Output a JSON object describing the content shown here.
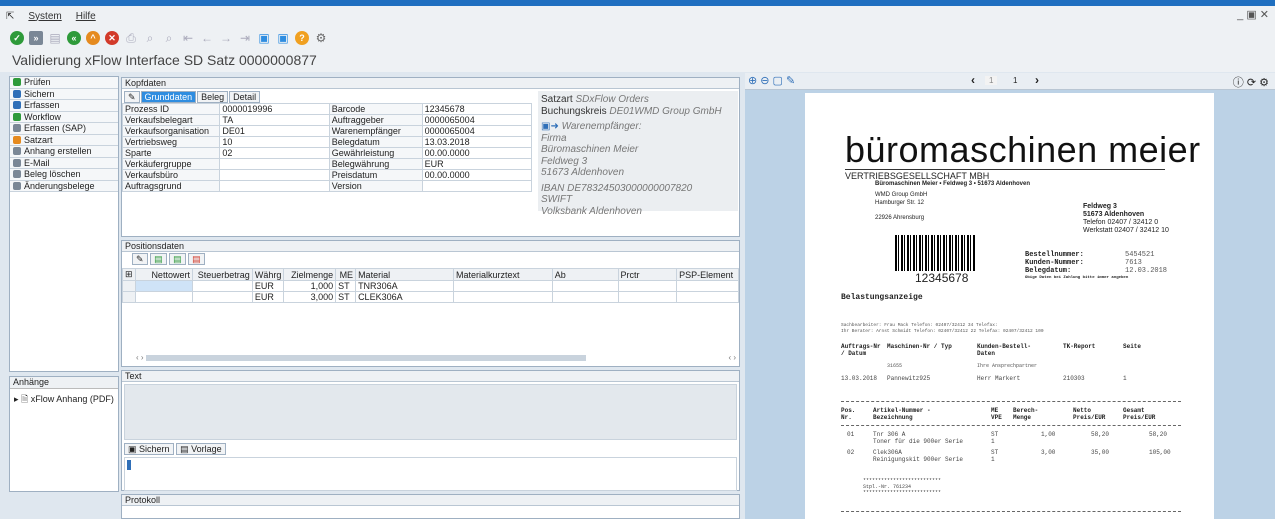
{
  "menu": {
    "system": "System",
    "hilfe": "Hilfe"
  },
  "title": "Validierung xFlow Interface SD Satz 0000000877",
  "nav": [
    "Prüfen",
    "Sichern",
    "Erfassen",
    "Workflow",
    "Erfassen (SAP)",
    "Satzart",
    "Anhang erstellen",
    "E-Mail",
    "Beleg löschen",
    "Änderungsbelege"
  ],
  "anhaenge": {
    "header": "Anhänge",
    "item": "xFlow Anhang (PDF)"
  },
  "kopf": {
    "header": "Kopfdaten",
    "tabs": [
      "Grunddaten",
      "Beleg",
      "Detail"
    ],
    "rows": [
      [
        "Prozess ID",
        "0000019996",
        "Barcode",
        "12345678"
      ],
      [
        "Verkaufsbelegart",
        "TA",
        "Auftraggeber",
        "0000065004"
      ],
      [
        "Verkaufsorganisation",
        "DE01",
        "Warenempfänger",
        "0000065004"
      ],
      [
        "Vertriebsweg",
        "10",
        "Belegdatum",
        "13.03.2018"
      ],
      [
        "Sparte",
        "02",
        "Gewährleistung",
        "00.00.0000"
      ],
      [
        "Verkäufergruppe",
        "",
        "Belegwährung",
        "EUR"
      ],
      [
        "Verkaufsbüro",
        "",
        "Preisdatum",
        "00.00.0000"
      ],
      [
        "Auftragsgrund",
        "",
        "Version",
        ""
      ]
    ]
  },
  "info": {
    "satzart_l": "Satzart",
    "satzart_v": "SDxFlow Orders",
    "bk_l": "Buchungskreis",
    "bk_v": "DE01WMD Group GmbH",
    "we": "Warenempfänger:",
    "l1": "Firma",
    "l2": "Büromaschinen Meier",
    "l3": "Feldweg 3",
    "l4": "51673 Aldenhoven",
    "l5": "IBAN DE78324503000000007820",
    "l6": "SWIFT",
    "l7": "Volksbank Aldenhoven"
  },
  "pos": {
    "header": "Positionsdaten",
    "cols": [
      "Nettowert",
      "Steuerbetrag",
      "Währg",
      "Zielmenge",
      "ME",
      "Material",
      "Materialkurztext",
      "Ab",
      "Prctr",
      "PSP-Element"
    ],
    "rows": [
      [
        "",
        "",
        "EUR",
        "1,000",
        "ST",
        "TNR306A",
        "",
        "",
        "",
        ""
      ],
      [
        "",
        "",
        "EUR",
        "3,000",
        "ST",
        "CLEK306A",
        "",
        "",
        "",
        ""
      ]
    ]
  },
  "text": {
    "header": "Text",
    "sichern": "Sichern",
    "vorlage": "Vorlage"
  },
  "protokoll": "Protokoll",
  "viewer": {
    "page": "1",
    "of": "1"
  },
  "doc": {
    "brand": "büromaschinen meier",
    "sub": "VERTRIEBSGESELLSCHAFT MBH",
    "sender": "Büromaschinen Meier • Feldweg 3 • 51673 Aldenhoven",
    "to1": "WMD Group GmbH",
    "to2": "Hamburger Str. 12",
    "to3": "22926 Ahrensburg",
    "a1": "Feldweg 3",
    "a2": "51673 Aldenhoven",
    "a3": "Telefon 02407 / 32412 0",
    "a4": "Werkstatt 02407 / 32412 10",
    "barcode": "12345678",
    "bn_l": "Bestellnummer:",
    "bn_v": "5454521",
    "kn_l": "Kunden-Nummer:",
    "kn_v": "7613",
    "bd_l": "Belegdatum:",
    "bd_v": "12.03.2018",
    "note": "Obige Daten bei Zahlung bitte immer angeben",
    "heading": "Belastungsanzeige",
    "c1": "Sachbearbeiter: Frau Mack   Telefon: 02407/32412 34    Telefax:",
    "c2": "Ihr Berater: Arnst Schmidt  Telefon: 02407/32412 22    Telefax: 02407/32412 100",
    "h1": "Auftrags-Nr / Datum",
    "h2": "Maschinen-Nr / Typ",
    "h2b": "31655",
    "h3": "Kunden-Bestell-Daten",
    "h3b": "Ihre Ansprechpartner",
    "h4": "TK-Report",
    "h5": "Seite",
    "r1": "13.03.2018",
    "r2": "Pannewitz925",
    "r3": "Herr Markert",
    "r4": "210303",
    "r5": "1",
    "th1": "Pos. Nr.",
    "th2": "Artikel-Nummer -Bezeichnung",
    "th3": "ME VPE",
    "th4": "Berech- Menge",
    "th5": "Netto Preis/EUR",
    "th6": "Gesamt Preis/EUR",
    "i1": [
      "01",
      "Tnr 306 A",
      "Toner für die 900er Serie",
      "ST",
      "1",
      "1,00",
      "58,20",
      "58,20"
    ],
    "i2": [
      "02",
      "Clek306A",
      "Reinigungskit 900er Serie",
      "ST",
      "1",
      "3,00",
      "35,00",
      "105,00"
    ],
    "stars": "**************************",
    "stpl": "Stpl.-Nr. 761234"
  }
}
